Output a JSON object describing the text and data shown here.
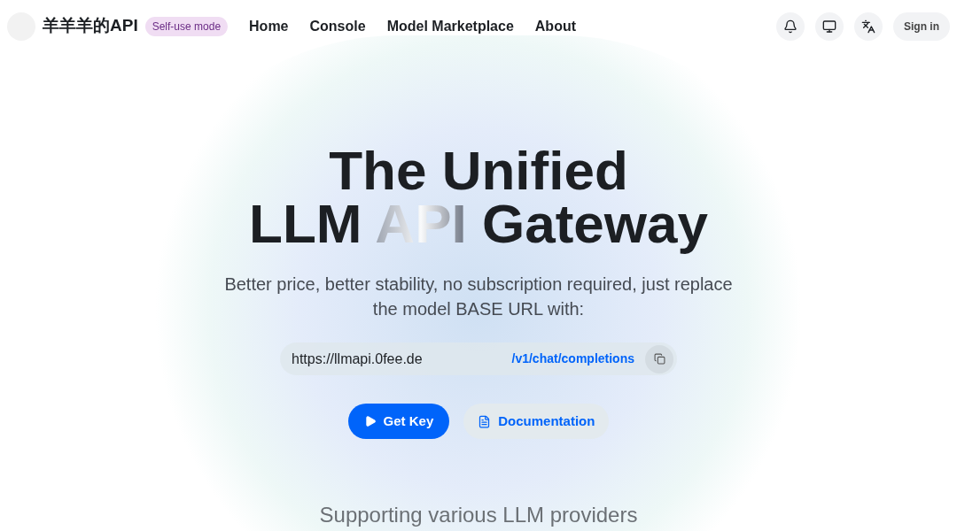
{
  "brand": {
    "name": "羊羊羊的API",
    "badge": "Self-use mode"
  },
  "nav": [
    {
      "label": "Home"
    },
    {
      "label": "Console"
    },
    {
      "label": "Model Marketplace"
    },
    {
      "label": "About"
    }
  ],
  "header_actions": {
    "sign_in": "Sign in"
  },
  "hero": {
    "title_line_1": [
      {
        "text": "The Unified",
        "highlight": false
      }
    ],
    "title_line_2": [
      {
        "text": "LLM ",
        "highlight": false
      },
      {
        "text": "API",
        "highlight": true
      },
      {
        "text": " Gateway",
        "highlight": false
      }
    ],
    "subtitle": "Better price, better stability, no subscription required, just replace the model BASE URL with:",
    "base_url": "https://llmapi.0fee.de",
    "endpoint": "/v1/chat/completions",
    "buttons": [
      {
        "kind": "primary",
        "label": "Get Key"
      },
      {
        "kind": "secondary",
        "label": "Documentation"
      }
    ]
  },
  "providers_heading": "Supporting various LLM providers"
}
